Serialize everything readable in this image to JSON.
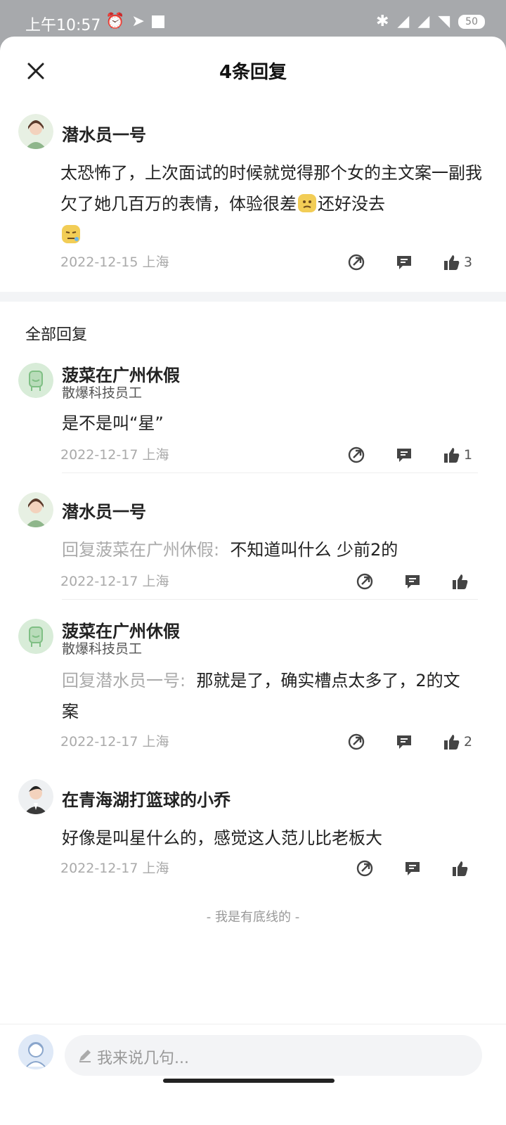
{
  "status_bar": {
    "time": "上午10:57",
    "battery": "50"
  },
  "header": {
    "title": "4条回复"
  },
  "main_comment": {
    "author": "潜水员一号",
    "text_part1": "太恐怖了，上次面试的时候就觉得那个女的主文案一副我欠了她几百万的表情，体验很差",
    "text_part2": "还好没去",
    "date_location": "2022-12-15 上海",
    "like_count": "3"
  },
  "section_title": "全部回复",
  "replies": [
    {
      "author": "菠菜在广州休假",
      "subtitle": "散爆科技员工",
      "reply_to": "",
      "text": "是不是叫“星”",
      "date_location": "2022-12-17 上海",
      "like_count": "1"
    },
    {
      "author": "潜水员一号",
      "subtitle": "",
      "reply_to": "回复菠菜在广州休假:",
      "text": "不知道叫什么 少前2的",
      "date_location": "2022-12-17 上海",
      "like_count": ""
    },
    {
      "author": "菠菜在广州休假",
      "subtitle": "散爆科技员工",
      "reply_to": "回复潜水员一号:",
      "text": "那就是了，确实槽点太多了，2的文案",
      "date_location": "2022-12-17 上海",
      "like_count": "2"
    },
    {
      "author": "在青海湖打篮球的小乔",
      "subtitle": "",
      "reply_to": "",
      "text": "好像是叫星什么的，感觉这人范儿比老板大",
      "date_location": "2022-12-17 上海",
      "like_count": ""
    }
  ],
  "footer_text": "- 我是有底线的 -",
  "input": {
    "placeholder": "我来说几句..."
  },
  "icons": [
    "close-icon",
    "share-icon",
    "comment-icon",
    "thumbs-up-icon",
    "pencil-icon"
  ]
}
